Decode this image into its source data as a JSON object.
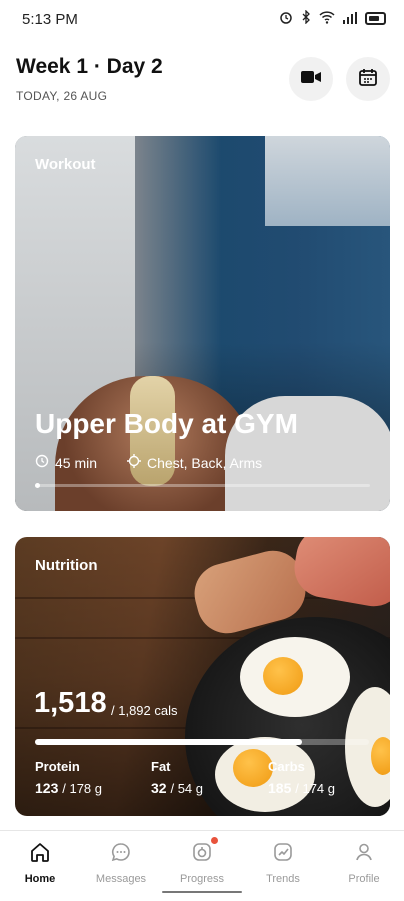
{
  "status_bar": {
    "time": "5:13 PM",
    "icons": [
      "alarm-icon",
      "bluetooth-icon",
      "wifi-icon",
      "signal-icon",
      "battery-icon"
    ]
  },
  "header": {
    "title": "Week 1 · Day 2",
    "subtitle": "TODAY, 26 AUG",
    "actions": [
      {
        "icon": "video-camera-icon"
      },
      {
        "icon": "calendar-icon"
      }
    ]
  },
  "workout_card": {
    "label": "Workout",
    "title": "Upper Body at GYM",
    "duration": "45 min",
    "muscles": "Chest, Back, Arms",
    "duration_icon": "clock-icon",
    "muscles_icon": "target-icon"
  },
  "nutrition_card": {
    "label": "Nutrition",
    "calories_consumed": "1,518",
    "calories_total": "/ 1,892 cals",
    "calorie_progress": 0.8,
    "macros": [
      {
        "label": "Protein",
        "value": "123",
        "total": "/ 178 g"
      },
      {
        "label": "Fat",
        "value": "32",
        "total": "/ 54 g"
      },
      {
        "label": "Carbs",
        "value": "185",
        "total": "/ 174 g"
      }
    ]
  },
  "nav": {
    "items": [
      {
        "label": "Home",
        "icon": "home-icon",
        "active": true
      },
      {
        "label": "Messages",
        "icon": "chat-icon",
        "active": false
      },
      {
        "label": "Progress",
        "icon": "progress-icon",
        "active": false,
        "badge": true
      },
      {
        "label": "Trends",
        "icon": "trends-icon",
        "active": false
      },
      {
        "label": "Profile",
        "icon": "profile-icon",
        "active": false
      }
    ]
  },
  "colors": {
    "accent": "#e8533c",
    "text_primary": "#111111",
    "text_muted": "#9a9a9a"
  }
}
